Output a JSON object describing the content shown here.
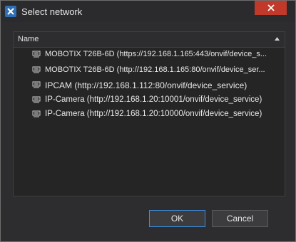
{
  "window": {
    "title": "Select network"
  },
  "list": {
    "header": "Name",
    "items": [
      {
        "label": "MOBOTIX T26B-6D (https://192.168.1.165:443/onvif/device_s..."
      },
      {
        "label": "MOBOTIX T26B-6D (http://192.168.1.165:80/onvif/device_ser..."
      },
      {
        "label": "IPCAM (http://192.168.1.112:80/onvif/device_service)"
      },
      {
        "label": "IP-Camera (http://192.168.1.20:10001/onvif/device_service)"
      },
      {
        "label": "IP-Camera (http://192.168.1.20:10000/onvif/device_service)"
      }
    ]
  },
  "buttons": {
    "ok": "OK",
    "cancel": "Cancel"
  },
  "colors": {
    "close": "#c0392b",
    "focus": "#3b8de0"
  }
}
